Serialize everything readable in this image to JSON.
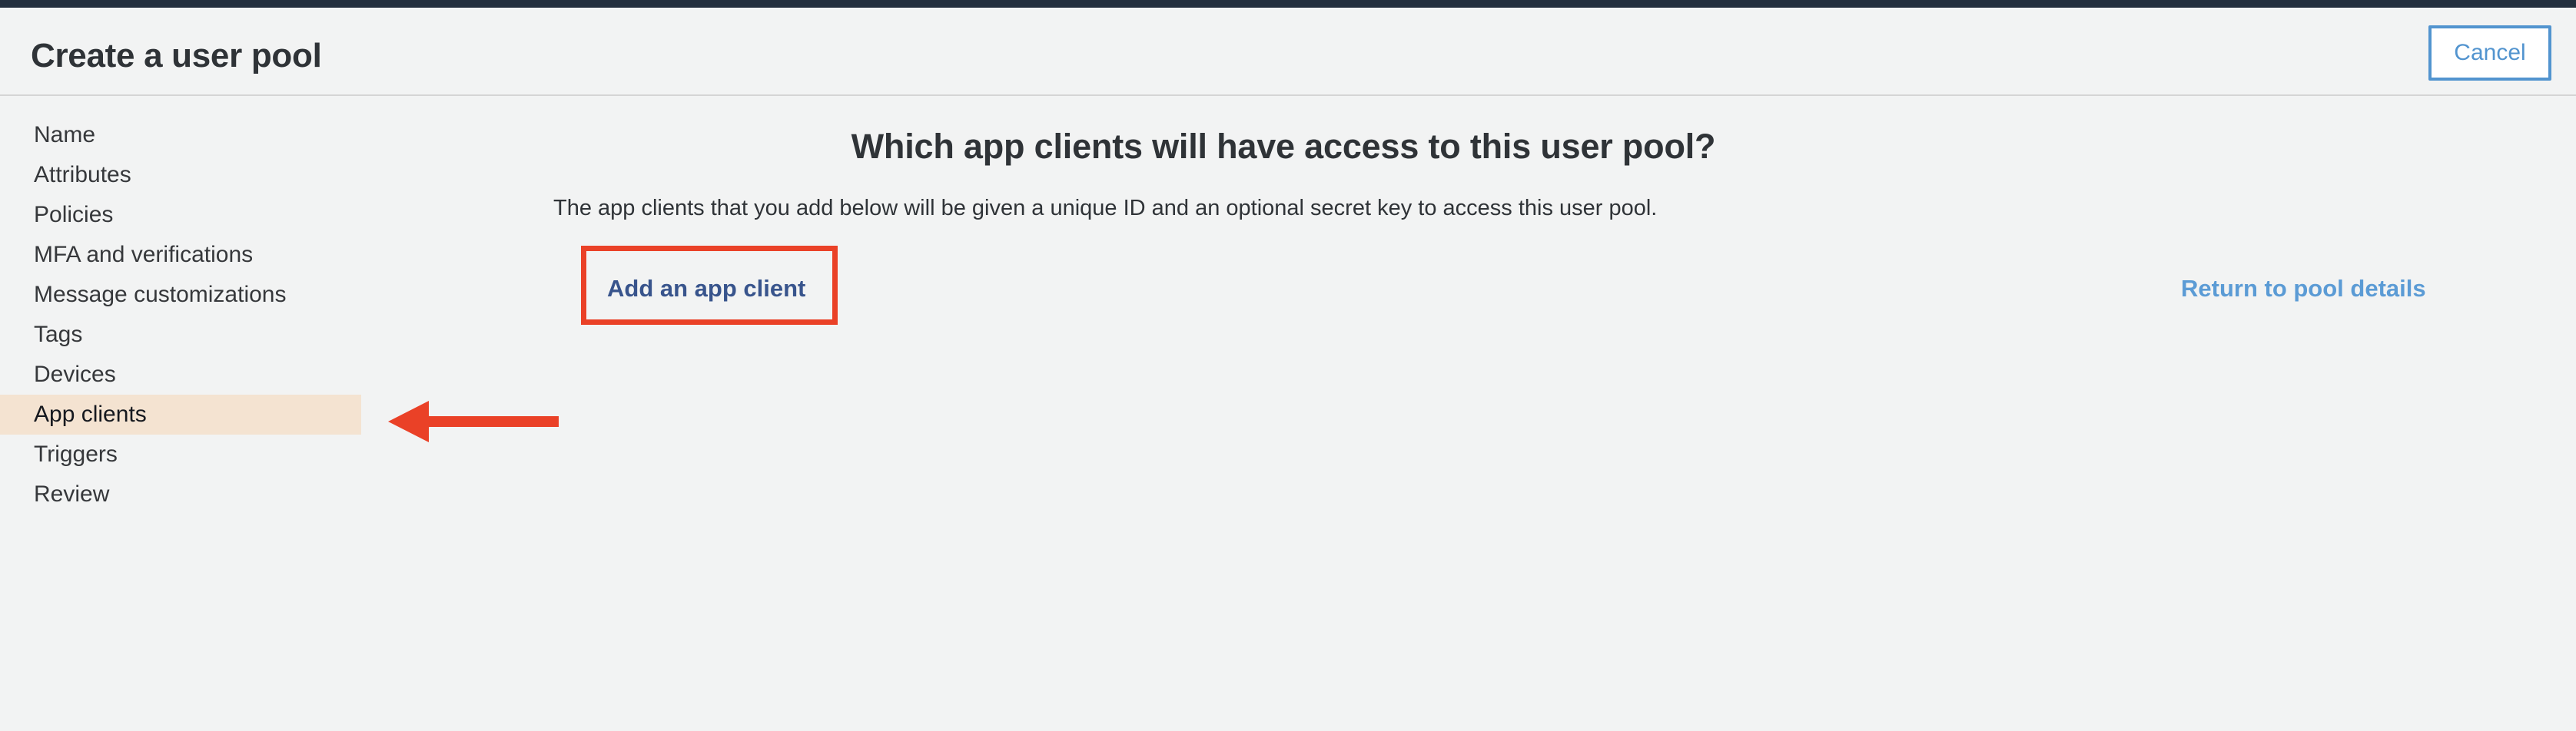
{
  "header": {
    "title": "Create a user pool",
    "cancel_label": "Cancel"
  },
  "sidebar": {
    "items": [
      {
        "label": "Name",
        "selected": false
      },
      {
        "label": "Attributes",
        "selected": false
      },
      {
        "label": "Policies",
        "selected": false
      },
      {
        "label": "MFA and verifications",
        "selected": false
      },
      {
        "label": "Message customizations",
        "selected": false
      },
      {
        "label": "Tags",
        "selected": false
      },
      {
        "label": "Devices",
        "selected": false
      },
      {
        "label": "App clients",
        "selected": true
      },
      {
        "label": "Triggers",
        "selected": false
      },
      {
        "label": "Review",
        "selected": false
      }
    ]
  },
  "main": {
    "heading": "Which app clients will have access to this user pool?",
    "description": "The app clients that you add below will be given a unique ID and an optional secret key to access this user pool.",
    "add_client_label": "Add an app client",
    "return_link_label": "Return to pool details"
  },
  "annotations": {
    "highlight_box_target": "Add an app client",
    "arrow_target": "App clients",
    "color": "#ea4127"
  },
  "colors": {
    "top_strip": "#232f3e",
    "page_background": "#f2f3f3",
    "selected_nav": "#f4e3d1",
    "cancel_border": "#5294cf",
    "primary_link": "#38548c",
    "secondary_link": "#5b9bd5",
    "annotation": "#ea4127"
  }
}
